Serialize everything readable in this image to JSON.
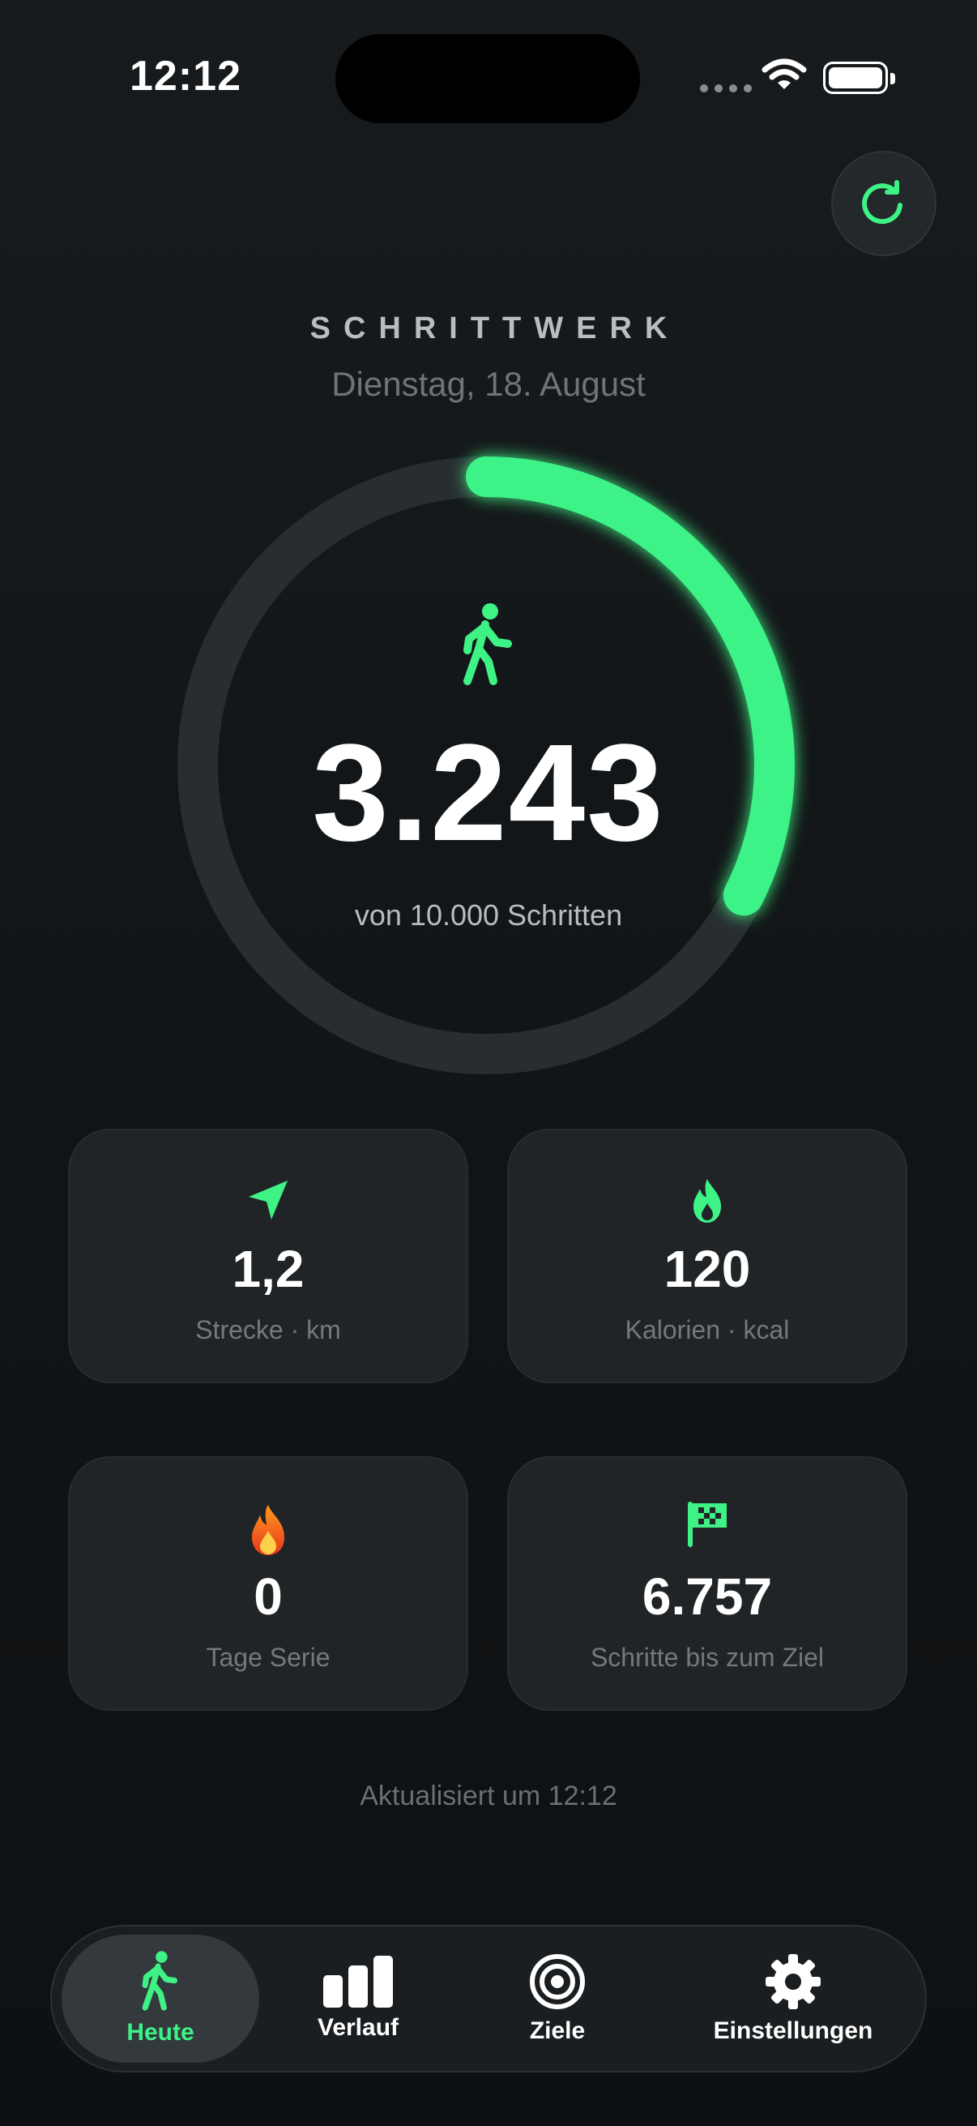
{
  "status_bar": {
    "time": "12:12"
  },
  "header": {
    "app_title": "SCHRITTWERK",
    "date": "Dienstag, 18. August"
  },
  "progress": {
    "steps": "3.243",
    "goal_text": "von 10.000 Schritten",
    "fraction": 0.3243,
    "accent_color": "#3ef286"
  },
  "stats": [
    {
      "icon": "location-arrow-icon",
      "value": "1,2",
      "label": "Strecke · km"
    },
    {
      "icon": "flame-icon",
      "value": "120",
      "label": "Kalorien · kcal"
    },
    {
      "icon": "fire-emoji-icon",
      "value": "0",
      "label": "Tage Serie"
    },
    {
      "icon": "checkered-flag-icon",
      "value": "6.757",
      "label": "Schritte bis zum Ziel"
    }
  ],
  "updated": "Aktualisiert um 12:12",
  "tabs": [
    {
      "label": "Heute",
      "icon": "walk-icon",
      "active": true
    },
    {
      "label": "Verlauf",
      "icon": "bar-chart-icon"
    },
    {
      "label": "Ziele",
      "icon": "target-icon"
    },
    {
      "label": "Einstellungen",
      "icon": "gear-icon"
    }
  ]
}
